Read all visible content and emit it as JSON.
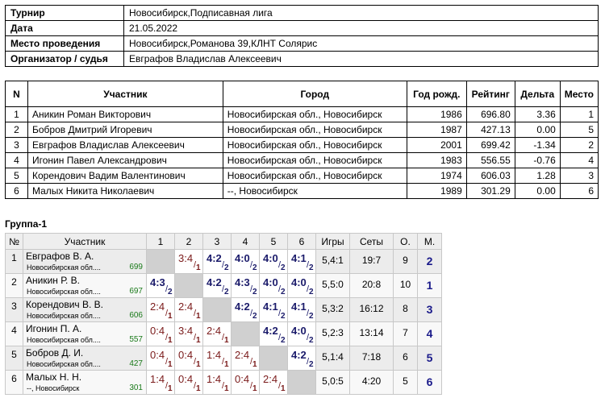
{
  "info": {
    "rows": [
      {
        "key": "Турнир",
        "value": "Новосибирск,Подписавная лига"
      },
      {
        "key": "Дата",
        "value": "21.05.2022"
      },
      {
        "key": "Место проведения",
        "value": "Новосибирск,Романова 39,КЛНТ Солярис"
      },
      {
        "key": "Организатор / судья",
        "value": "Евграфов Владислав Алексеевич"
      }
    ]
  },
  "participants": {
    "headers": [
      "N",
      "Участник",
      "Город",
      "Год рожд.",
      "Рейтинг",
      "Дельта",
      "Место"
    ],
    "rows": [
      [
        "1",
        "Аникин Роман Викторович",
        "Новосибирская обл., Новосибирск",
        "1986",
        "696.80",
        "3.36",
        "1"
      ],
      [
        "2",
        "Бобров Дмитрий Игоревич",
        "Новосибирская обл., Новосибирск",
        "1987",
        "427.13",
        "0.00",
        "5"
      ],
      [
        "3",
        "Евграфов Владислав Алексеевич",
        "Новосибирская обл., Новосибирск",
        "2001",
        "699.42",
        "-1.34",
        "2"
      ],
      [
        "4",
        "Игонин Павел Александрович",
        "Новосибирская обл., Новосибирск",
        "1983",
        "556.55",
        "-0.76",
        "4"
      ],
      [
        "5",
        "Корендович Вадим Валентинович",
        "Новосибирская обл., Новосибирск",
        "1974",
        "606.03",
        "1.28",
        "3"
      ],
      [
        "6",
        "Малых Никита Николаевич",
        "--, Новосибирск",
        "1989",
        "301.29",
        "0.00",
        "6"
      ]
    ]
  },
  "group": {
    "title": "Группа-1",
    "headers": [
      "№",
      "Участник",
      "1",
      "2",
      "3",
      "4",
      "5",
      "6",
      "Игры",
      "Сеты",
      "О.",
      "М."
    ],
    "rows": [
      {
        "n": "1",
        "name": "Евграфов В. А.",
        "city": "Новосибирская обл....",
        "rating": "699",
        "cells": [
          null,
          {
            "s": "3:4",
            "r": "1",
            "w": false
          },
          {
            "s": "4:2",
            "r": "2",
            "w": true
          },
          {
            "s": "4:0",
            "r": "2",
            "w": true
          },
          {
            "s": "4:0",
            "r": "2",
            "w": true
          },
          {
            "s": "4:1",
            "r": "2",
            "w": true
          }
        ],
        "games": "5,4:1",
        "sets": "19:7",
        "pts": "9",
        "place": "2"
      },
      {
        "n": "2",
        "name": "Аникин Р. В.",
        "city": "Новосибирская обл....",
        "rating": "697",
        "cells": [
          {
            "s": "4:3",
            "r": "2",
            "w": true
          },
          null,
          {
            "s": "4:2",
            "r": "2",
            "w": true
          },
          {
            "s": "4:3",
            "r": "2",
            "w": true
          },
          {
            "s": "4:0",
            "r": "2",
            "w": true
          },
          {
            "s": "4:0",
            "r": "2",
            "w": true
          }
        ],
        "games": "5,5:0",
        "sets": "20:8",
        "pts": "10",
        "place": "1"
      },
      {
        "n": "3",
        "name": "Корендович В. В.",
        "city": "Новосибирская обл....",
        "rating": "606",
        "cells": [
          {
            "s": "2:4",
            "r": "1",
            "w": false
          },
          {
            "s": "2:4",
            "r": "1",
            "w": false
          },
          null,
          {
            "s": "4:2",
            "r": "2",
            "w": true
          },
          {
            "s": "4:1",
            "r": "2",
            "w": true
          },
          {
            "s": "4:1",
            "r": "2",
            "w": true
          }
        ],
        "games": "5,3:2",
        "sets": "16:12",
        "pts": "8",
        "place": "3"
      },
      {
        "n": "4",
        "name": "Игонин П. А.",
        "city": "Новосибирская обл....",
        "rating": "557",
        "cells": [
          {
            "s": "0:4",
            "r": "1",
            "w": false
          },
          {
            "s": "3:4",
            "r": "1",
            "w": false
          },
          {
            "s": "2:4",
            "r": "1",
            "w": false
          },
          null,
          {
            "s": "4:2",
            "r": "2",
            "w": true
          },
          {
            "s": "4:0",
            "r": "2",
            "w": true
          }
        ],
        "games": "5,2:3",
        "sets": "13:14",
        "pts": "7",
        "place": "4"
      },
      {
        "n": "5",
        "name": "Бобров Д. И.",
        "city": "Новосибирская обл....",
        "rating": "427",
        "cells": [
          {
            "s": "0:4",
            "r": "1",
            "w": false
          },
          {
            "s": "0:4",
            "r": "1",
            "w": false
          },
          {
            "s": "1:4",
            "r": "1",
            "w": false
          },
          {
            "s": "2:4",
            "r": "1",
            "w": false
          },
          null,
          {
            "s": "4:2",
            "r": "2",
            "w": true
          }
        ],
        "games": "5,1:4",
        "sets": "7:18",
        "pts": "6",
        "place": "5"
      },
      {
        "n": "6",
        "name": "Малых Н. Н.",
        "city": "--, Новосибирск",
        "rating": "301",
        "cells": [
          {
            "s": "1:4",
            "r": "1",
            "w": false
          },
          {
            "s": "0:4",
            "r": "1",
            "w": false
          },
          {
            "s": "1:4",
            "r": "1",
            "w": false
          },
          {
            "s": "0:4",
            "r": "1",
            "w": false
          },
          {
            "s": "2:4",
            "r": "1",
            "w": false
          },
          null
        ],
        "games": "5,0:5",
        "sets": "4:20",
        "pts": "5",
        "place": "6"
      }
    ]
  }
}
